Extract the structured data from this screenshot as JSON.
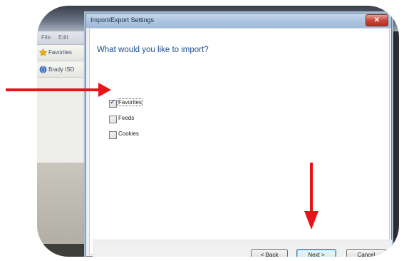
{
  "background": {
    "menu_items": [
      "File",
      "Edit"
    ],
    "left_items": [
      {
        "label": "Favorites",
        "icon": "star-icon"
      },
      {
        "label": "Brady ISD",
        "icon": "globe-icon"
      }
    ]
  },
  "dialog": {
    "title": "Import/Export Settings",
    "close_glyph": "✕",
    "heading": "What would you like to import?",
    "options": [
      {
        "label": "Favorites",
        "checked": true
      },
      {
        "label": "Feeds",
        "checked": false
      },
      {
        "label": "Cookies",
        "checked": false
      }
    ],
    "buttons": {
      "back": "< Back",
      "next": "Next >",
      "cancel": "Cancel"
    }
  },
  "annotations": {
    "arrow_color": "#e8141a"
  },
  "colors": {
    "heading": "#1f4d8c",
    "titlebar": "#aec6e2",
    "close": "#c9473a"
  }
}
